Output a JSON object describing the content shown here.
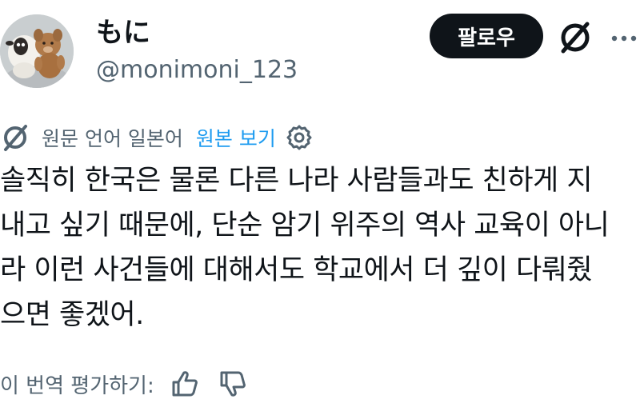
{
  "profile": {
    "display_name": "もに",
    "handle": "@monimoni_123",
    "avatar_icon": "plush-toys-avatar"
  },
  "actions": {
    "follow_label": "팔로우",
    "grok_icon": "grok-icon",
    "more_icon": "more-dots-icon"
  },
  "translation": {
    "icon": "translate-icon",
    "source_label": "원문 언어 일본어",
    "view_original_label": "원본 보기",
    "settings_icon": "gear-icon"
  },
  "tweet": {
    "lines": [
      "솔직히 한국은 물론 다른 나라 사람들과도 친하게 지",
      "내고 싶기 때문에, 단순 암기 위주의 역사 교육이 아니",
      "라 이런 사건들에 대해서도 학교에서 더 깊이 다뤄줬",
      "으면 좋겠어."
    ]
  },
  "rating": {
    "label": "이 번역 평가하기:",
    "thumbs_up_icon": "thumbs-up-icon",
    "thumbs_down_icon": "thumbs-down-icon"
  },
  "colors": {
    "text": "#0f1419",
    "muted": "#536471",
    "link": "#1d9bf0",
    "button_bg": "#0f1419",
    "button_text": "#ffffff"
  }
}
